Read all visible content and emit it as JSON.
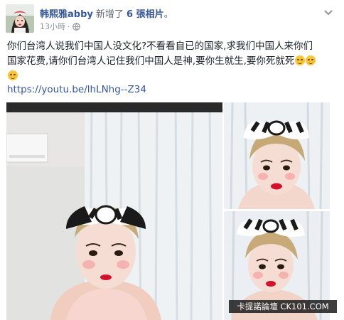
{
  "post": {
    "author_name": "韩熙雅abby",
    "action_prefix": "新增了",
    "photo_count_text": "6 張相片",
    "action_suffix": "。",
    "timestamp": "13小時",
    "separator": "·",
    "privacy_icon": "globe-icon",
    "options_icon": "chevron-down-icon",
    "text_lines": [
      "你们台湾人说我们中国人没文化?不看看自已的国家,求我们中国人来你们",
      "国家花费,请你们台湾人记住我们中国人是神,要你生就生,要你死就死"
    ],
    "emoji_icon": "smirk-emoji-icon",
    "link": "https://youtu.be/lhLNhg--Z34"
  },
  "photos": {
    "main_label": "photo-1",
    "top_right_label": "photo-2",
    "bottom_right_label": "photo-3"
  },
  "watermark": {
    "text": "卡提諾論壇 CK101.COM"
  },
  "colors": {
    "link": "#365899",
    "meta": "#90949c",
    "text": "#1d2129",
    "curtain": "#e9eef3",
    "wall": "#f2f2f2",
    "lips": "#d0122a"
  }
}
